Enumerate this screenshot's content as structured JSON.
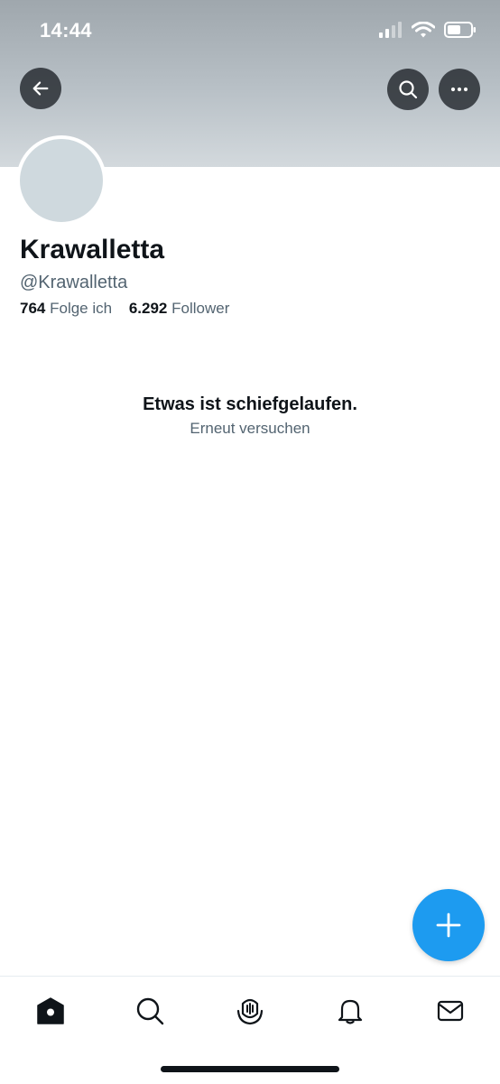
{
  "status_bar": {
    "time": "14:44",
    "icons": [
      "signal-icon",
      "wifi-icon",
      "battery-icon"
    ]
  },
  "header": {
    "back_icon": "arrow-left-icon",
    "search_icon": "search-icon",
    "more_icon": "more-horizontal-icon"
  },
  "profile": {
    "display_name": "Krawalletta",
    "handle": "@Krawalletta",
    "following_count": "764",
    "following_label": "Folge ich",
    "followers_count": "6.292",
    "followers_label": "Follower"
  },
  "error": {
    "title": "Etwas ist schiefgelaufen.",
    "retry_label": "Erneut versuchen"
  },
  "fab": {
    "icon": "plus-icon"
  },
  "tab_bar": {
    "items": [
      "home-icon",
      "search-icon",
      "spaces-icon",
      "bell-icon",
      "mail-icon"
    ]
  },
  "colors": {
    "accent": "#1d9bf0",
    "text_primary": "#0f1419",
    "text_secondary": "#536471",
    "avatar_placeholder": "#cfd9de"
  }
}
